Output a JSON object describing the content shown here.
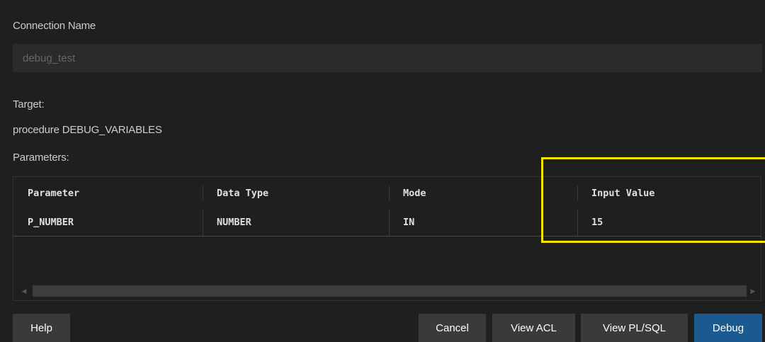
{
  "connection": {
    "label": "Connection Name",
    "value": "debug_test"
  },
  "target": {
    "label": "Target:",
    "value": "procedure DEBUG_VARIABLES"
  },
  "parameters": {
    "label": "Parameters:",
    "columns": [
      "Parameter",
      "Data Type",
      "Mode",
      "Input Value"
    ],
    "rows": [
      [
        "P_NUMBER",
        "NUMBER",
        "IN",
        "15"
      ]
    ]
  },
  "scrollbar": {
    "left_arrow": "◀",
    "right_arrow": "▶"
  },
  "buttons": {
    "help": "Help",
    "cancel": "Cancel",
    "view_acl": "View ACL",
    "view_plsql": "View PL/SQL",
    "debug": "Debug"
  },
  "colors": {
    "background": "#1f1f1f",
    "highlight": "#f5e400",
    "primary_button": "#1b5a8f"
  }
}
